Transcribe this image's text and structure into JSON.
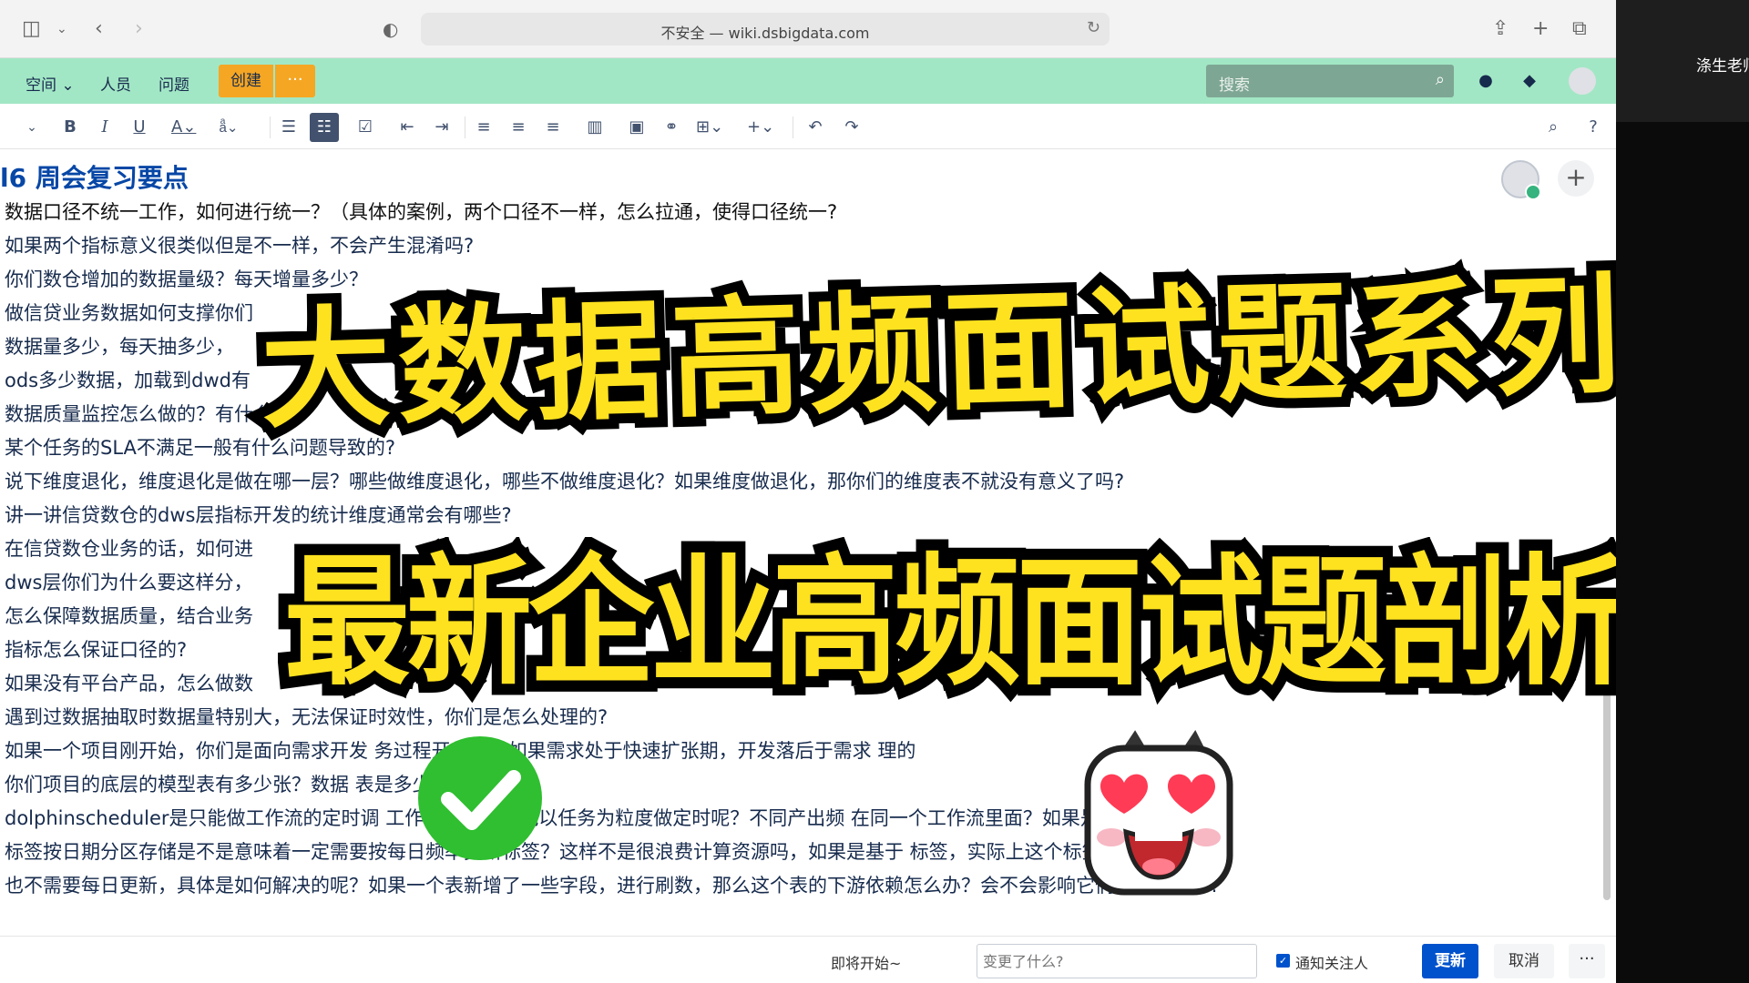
{
  "browser": {
    "address": "不安全 — wiki.dsbigdata.com"
  },
  "header": {
    "nav": [
      "空间",
      "人员",
      "问题"
    ],
    "create_label": "创建",
    "more_label": "···",
    "search_placeholder": "搜索"
  },
  "document": {
    "title": "l6 周会复习要点",
    "lines": [
      "数据口径不统一工作，如何进行统一？（具体的案例，两个口径不一样，怎么拉通，使得口径统一?",
      "如果两个指标意义很类似但是不一样，不会产生混淆吗?",
      "你们数仓增加的数据量级？每天增量多少？",
      "做信贷业务数据如何支撑你们",
      "数据量多少，每天抽多少，",
      "ods多少数据，加载到dwd有",
      "数据质量监控怎么做的？有什么",
      "某个任务的SLA不满足一般有什么问题导致的?",
      "说下维度退化，维度退化是做在哪一层？哪些做维度退化，哪些不做维度退化？如果维度做退化，那你们的维度表不就没有意义了吗?",
      "讲一讲信贷数仓的dws层指标开发的统计维度通常会有哪些?",
      "在信贷数仓业务的话，如何进",
      "dws层你们为什么要这样分，",
      "怎么保障数据质量，结合业务",
      "指标怎么保证口径的?",
      "如果没有平台产品，怎么做数",
      "遇到过数据抽取时数据量特别大，无法保证时效性，你们是怎么处理的?",
      "如果一个项目刚开始，你们是面向需求开发          务过程开发的，如果需求处于快速扩张期，开发落后于需求                     理的",
      "你们项目的底层的模型表有多少张？数据              表是多少?",
      " dolphinscheduler是只能做工作流的定时调          工作流，那能不能以任务为粒度做定时呢？不同产出频                    在同一个工作流里面？如果是",
      "标签按日期分区存储是不是意味着一定需要按每日频率更新标签？这样不是很浪费计算资源吗，如果是基于                    标签，实际上这个标签很稳定，",
      "也不需要每日更新，具体是如何解决的呢？如果一个表新增了一些字段，进行刷数，那么这个表的下游依赖怎么办？会不会影响它们的产出任务?"
    ]
  },
  "overlay": {
    "headline": "大数据高频面试题系列",
    "subheadline": "最新企业高频面试题剖析"
  },
  "footer": {
    "status": "即将开始~",
    "change_placeholder": "变更了什么?",
    "notify_label": "通知关注人",
    "update_label": "更新",
    "cancel_label": "取消",
    "more_label": "···"
  },
  "side": {
    "name": "涤生老师"
  }
}
